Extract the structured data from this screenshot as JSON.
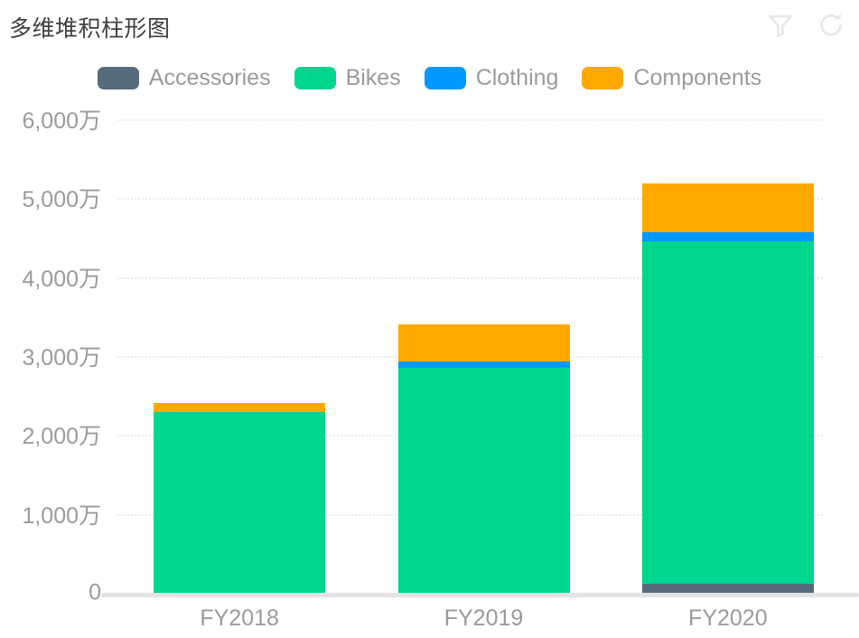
{
  "header": {
    "title": "多维堆积柱形图",
    "actions": [
      {
        "name": "filter-icon",
        "label": "Filter"
      },
      {
        "name": "refresh-icon",
        "label": "Refresh"
      }
    ]
  },
  "legend": {
    "position": "top-center",
    "items": [
      {
        "label": "Accessories",
        "color": "#566b7c"
      },
      {
        "label": "Bikes",
        "color": "#00d68f"
      },
      {
        "label": "Clothing",
        "color": "#0099ff"
      },
      {
        "label": "Components",
        "color": "#ffa800"
      }
    ]
  },
  "chart_data": {
    "type": "bar",
    "stacked": true,
    "title": "多维堆积柱形图",
    "xlabel": "",
    "ylabel": "",
    "grid": true,
    "ylim": [
      0,
      60000000
    ],
    "ytick_labels": [
      "0",
      "1,000万",
      "2,000万",
      "3,000万",
      "4,000万",
      "5,000万",
      "6,000万"
    ],
    "ytick_values": [
      0,
      10000000,
      20000000,
      30000000,
      40000000,
      50000000,
      60000000
    ],
    "categories": [
      "FY2018",
      "FY2019",
      "FY2020"
    ],
    "series": [
      {
        "name": "Accessories",
        "color": "#566b7c",
        "values": [
          0,
          0,
          1150000
        ]
      },
      {
        "name": "Bikes",
        "color": "#00d68f",
        "values": [
          22900000,
          28500000,
          43400000
        ]
      },
      {
        "name": "Clothing",
        "color": "#0099ff",
        "values": [
          0,
          800000,
          1150000
        ]
      },
      {
        "name": "Components",
        "color": "#ffa800",
        "values": [
          1150000,
          4700000,
          6200000
        ]
      }
    ],
    "totals": [
      24050000,
      34000000,
      51900000
    ]
  }
}
